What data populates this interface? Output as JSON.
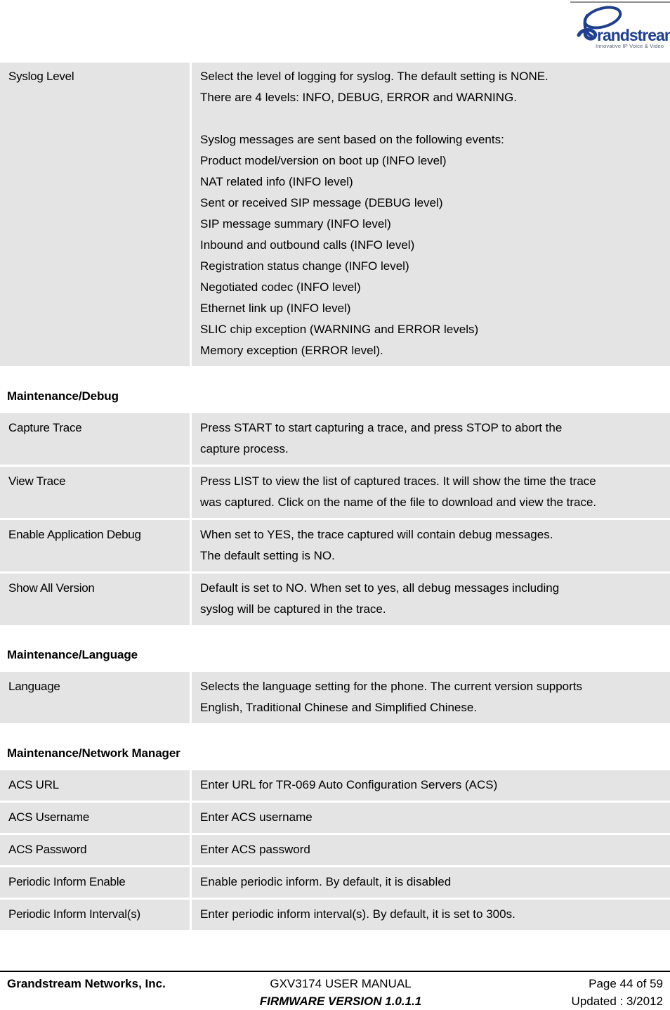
{
  "header": {
    "logo": {
      "icon": "grandstream-logo",
      "wordmark": "randstream",
      "tagline": "Innovative IP Voice & Video",
      "brand_color": "#1f3f8f"
    }
  },
  "sections": [
    {
      "id": "syslog",
      "heading": null,
      "rows": [
        {
          "label": "Syslog Level",
          "justify": false,
          "lines": [
            "Select the level of logging for syslog. The default setting is NONE.",
            "There are 4 levels: INFO, DEBUG, ERROR and WARNING.",
            "",
            "Syslog messages are sent based on the following events:",
            "Product model/version on boot up (INFO level)",
            "NAT related info (INFO level)",
            "Sent or received SIP message (DEBUG level)",
            "SIP message summary (INFO level)",
            "Inbound and outbound calls (INFO level)",
            "Registration status change (INFO level)",
            "Negotiated codec (INFO level)",
            "Ethernet link up (INFO level)",
            "SLIC chip exception (WARNING and ERROR levels)",
            "Memory exception (ERROR level)."
          ]
        }
      ]
    },
    {
      "id": "debug",
      "heading": "Maintenance/Debug",
      "rows": [
        {
          "label": "Capture Trace",
          "justify": true,
          "lines": [
            "Press START to start capturing a trace, and press STOP to abort the",
            "capture process."
          ]
        },
        {
          "label": "View Trace",
          "justify": true,
          "lines": [
            "Press LIST to view the list of captured traces. It will show the time the trace",
            "was captured. Click on the name of the file to download and view the trace."
          ]
        },
        {
          "label": "Enable Application Debug",
          "justify": false,
          "lines": [
            "When set to YES, the trace captured will contain debug messages.",
            "The default setting is NO."
          ]
        },
        {
          "label": "Show All Version",
          "justify": true,
          "lines": [
            "Default is set to NO.  When set to yes, all debug messages including",
            "syslog will be captured in the trace."
          ]
        }
      ]
    },
    {
      "id": "language",
      "heading": "Maintenance/Language",
      "rows": [
        {
          "label": "Language",
          "justify": true,
          "lines": [
            "Selects the language setting for the phone. The current version supports",
            "English, Traditional Chinese and Simplified Chinese."
          ]
        }
      ]
    },
    {
      "id": "network-manager",
      "heading": "Maintenance/Network Manager",
      "rows": [
        {
          "label": "ACS URL",
          "justify": false,
          "lines": [
            "Enter URL for TR-069 Auto Configuration Servers (ACS)"
          ]
        },
        {
          "label": "ACS Username",
          "justify": false,
          "lines": [
            "Enter ACS username"
          ]
        },
        {
          "label": "ACS Password",
          "justify": false,
          "lines": [
            "Enter ACS password"
          ]
        },
        {
          "label": "Periodic Inform Enable",
          "justify": false,
          "lines": [
            "Enable periodic inform. By default, it is disabled"
          ]
        },
        {
          "label": "Periodic Inform Interval(s)",
          "justify": false,
          "lines": [
            "Enter periodic inform interval(s). By default, it is set to 300s."
          ]
        }
      ]
    }
  ],
  "footer": {
    "company": "Grandstream Networks, Inc.",
    "manual_title": "GXV3174 USER MANUAL",
    "page_number": "Page 44 of 59",
    "firmware": "FIRMWARE VERSION 1.0.1.1",
    "updated": "Updated : 3/2012"
  }
}
